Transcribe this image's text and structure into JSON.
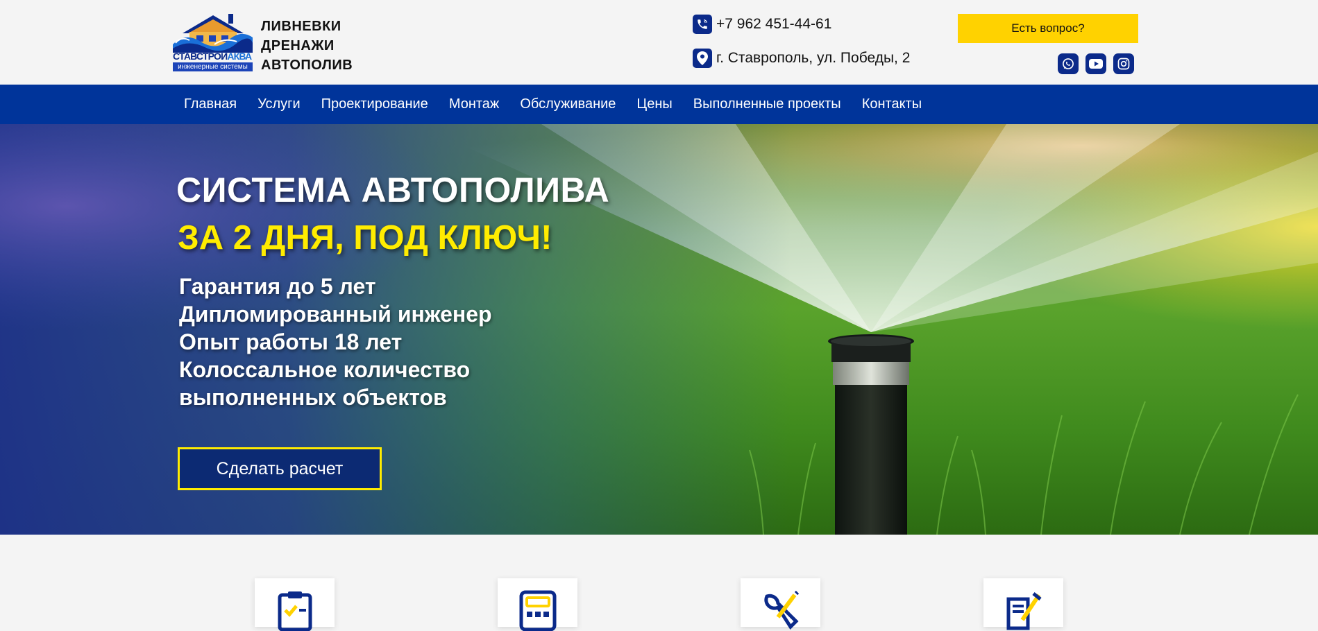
{
  "header": {
    "logo": {
      "name_part1": "СТАВСТРОЙ",
      "name_part2": "АКВА",
      "subtitle": "инженерные системы"
    },
    "tagline": [
      "ЛИВНЕВКИ",
      "ДРЕНАЖИ",
      "АВТОПОЛИВ"
    ],
    "phone": "+7 962 451-44-61",
    "address": "г. Ставрополь, ул. Победы, 2",
    "ask_button": "Есть вопрос?",
    "socials": [
      "whatsapp-icon",
      "youtube-icon",
      "instagram-icon"
    ]
  },
  "nav": {
    "items": [
      "Главная",
      "Услуги",
      "Проектирование",
      "Монтаж",
      "Обслуживание",
      "Цены",
      "Выполненные проекты",
      "Контакты"
    ]
  },
  "hero": {
    "title": "СИСТЕМА АВТОПОЛИВА",
    "subtitle": "ЗА 2 ДНЯ, ПОД КЛЮЧ!",
    "points": [
      "Гарантия до 5 лет",
      "Дипломированный инженер",
      "Опыт работы 18 лет",
      "Колоссальное количество",
      "выполненных объектов"
    ],
    "cta": "Сделать расчет"
  },
  "features": {
    "icons": [
      "clipboard-check-icon",
      "calculator-icon",
      "wrench-screwdriver-icon",
      "document-pen-icon"
    ]
  },
  "colors": {
    "brand_blue": "#00349a",
    "accent_yellow": "#ffd200",
    "hero_yellow": "#ffec00",
    "icon_blue": "#0b2a8a"
  }
}
